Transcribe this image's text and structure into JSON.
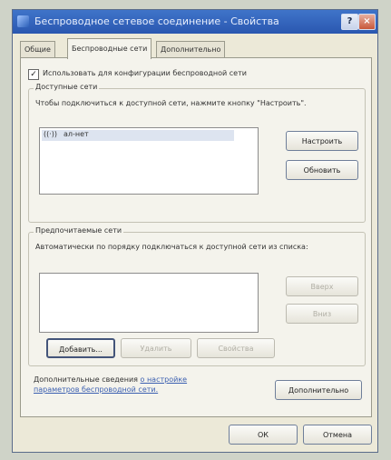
{
  "window": {
    "title": "Беспроводное сетевое соединение - Свойства",
    "help_glyph": "?",
    "close_glyph": "×"
  },
  "tabs": [
    {
      "label": "Общие",
      "active": false
    },
    {
      "label": "Беспроводные сети",
      "active": true
    },
    {
      "label": "Дополнительно",
      "active": false
    }
  ],
  "wireless": {
    "use_windows_checkbox": {
      "label": "Использовать для конфигурации беспроводной сети",
      "checked": true,
      "mark": "✓"
    },
    "available": {
      "title": "Доступные сети",
      "description": "Чтобы подключиться к доступной сети, нажмите кнопку \"Настроить\".",
      "networks": [
        {
          "name": "ал-нет",
          "icon": "wireless-signal-icon"
        }
      ],
      "configure_button": "Настроить",
      "refresh_button": "Обновить"
    },
    "preferred": {
      "title": "Предпочитаемые сети",
      "description": "Автоматически по порядку подключаться к доступной сети из списка:",
      "up_button": "Вверх",
      "down_button": "Вниз",
      "add_button": "Добавить...",
      "remove_button": "Удалить",
      "properties_button": "Свойства"
    },
    "footer": {
      "text": "Дополнительные сведения",
      "link": "о настройке параметров беспроводной сети.",
      "advanced_button": "Дополнительно"
    }
  },
  "dialog_buttons": {
    "ok": "ОК",
    "cancel": "Отмена"
  },
  "colors": {
    "titlebar": "#2a57b0",
    "link": "#3b5fb0",
    "panel": "#f4f3ec"
  }
}
